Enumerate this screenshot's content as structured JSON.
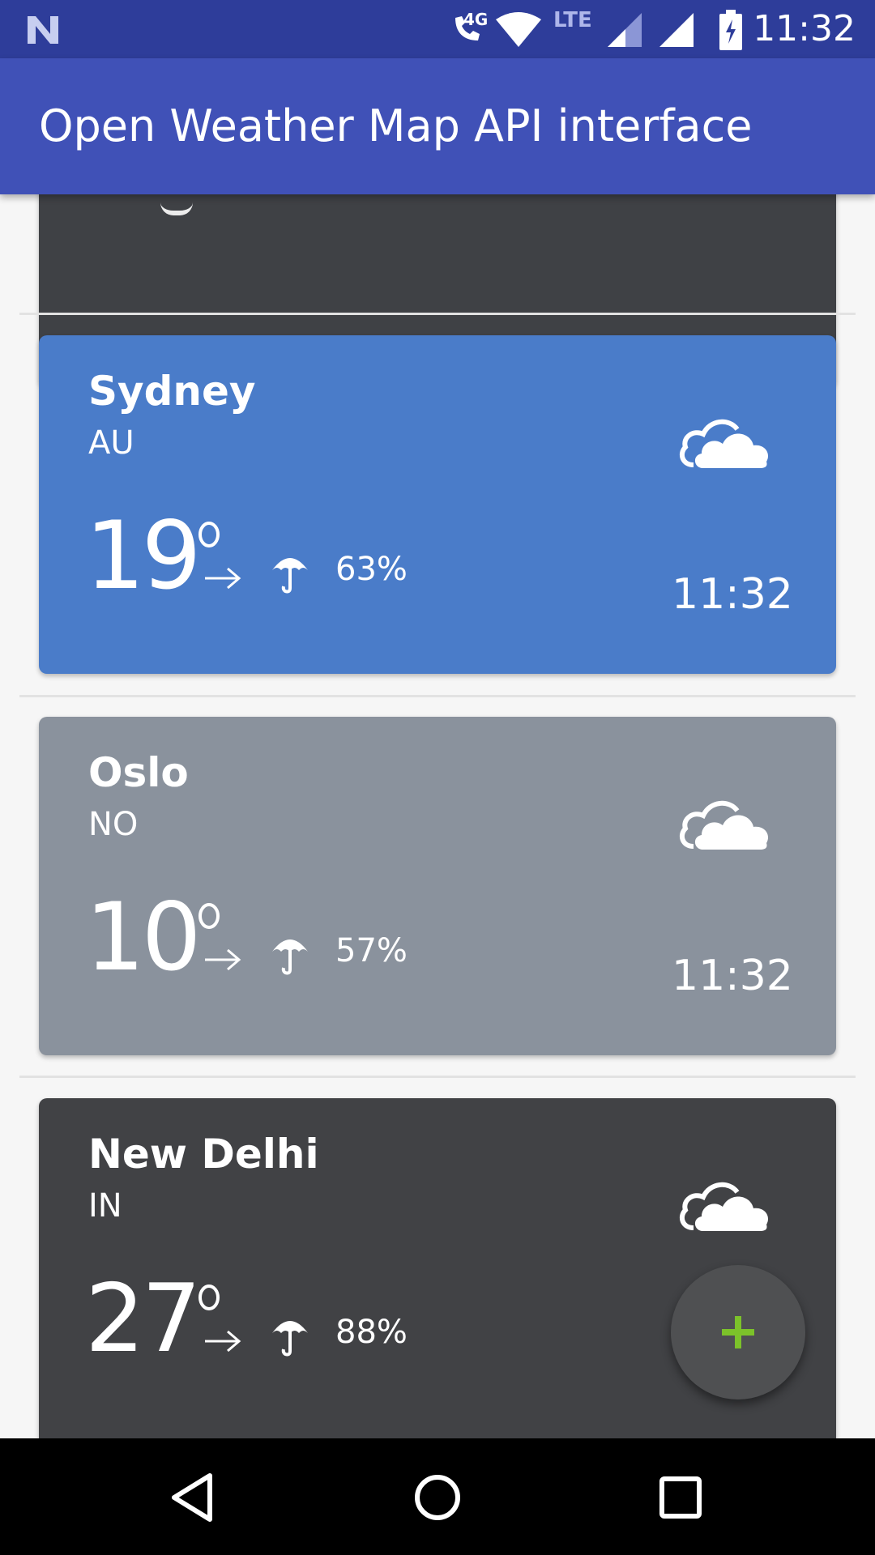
{
  "status_bar": {
    "network": "4G",
    "signal_type": "LTE",
    "time": "11:32"
  },
  "app_bar": {
    "title": "Open Weather Map API interface"
  },
  "cities": [
    {
      "name": "Sydney",
      "country": "AU",
      "temperature": "19",
      "humidity": "63%",
      "time": "11:32",
      "card_color": "#4a7cc9",
      "icon": "cloud-icon"
    },
    {
      "name": "Oslo",
      "country": "NO",
      "temperature": "10",
      "humidity": "57%",
      "time": "11:32",
      "card_color": "#8a929d",
      "icon": "cloud-icon"
    },
    {
      "name": "New Delhi",
      "country": "IN",
      "temperature": "27",
      "humidity": "88%",
      "card_color": "#414245",
      "icon": "cloud-icon"
    }
  ],
  "partial_card_color": "#3f4145",
  "fab": {
    "icon": "plus-icon",
    "icon_color": "#7cc22a",
    "background": "#4f5052"
  },
  "colors": {
    "status_bar": "#2e3d9a",
    "app_bar": "#4051b7"
  },
  "nav_bar": {
    "back_icon": "back-triangle-icon",
    "home_icon": "home-circle-icon",
    "recents_icon": "recents-square-icon"
  }
}
